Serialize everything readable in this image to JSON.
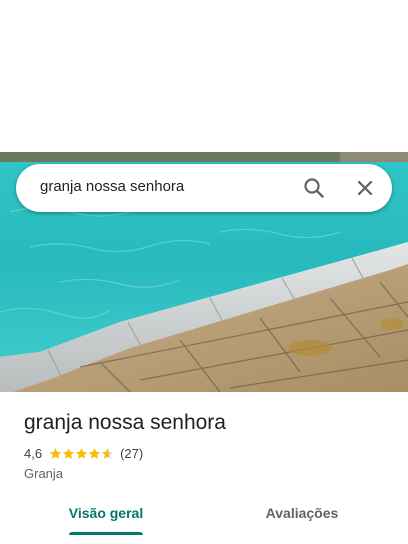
{
  "search": {
    "query": "granja nossa senhora"
  },
  "place": {
    "title": "granja nossa senhora",
    "rating": "4,6",
    "rating_stars": 4.6,
    "review_count": "(27)",
    "category": "Granja"
  },
  "tabs": [
    {
      "label": "Visão geral",
      "active": true
    },
    {
      "label": "Avaliações",
      "active": false
    }
  ],
  "colors": {
    "accent": "#00796b",
    "star": "#fbbc04"
  },
  "icons": {
    "search": "search-icon",
    "close": "close-icon"
  }
}
